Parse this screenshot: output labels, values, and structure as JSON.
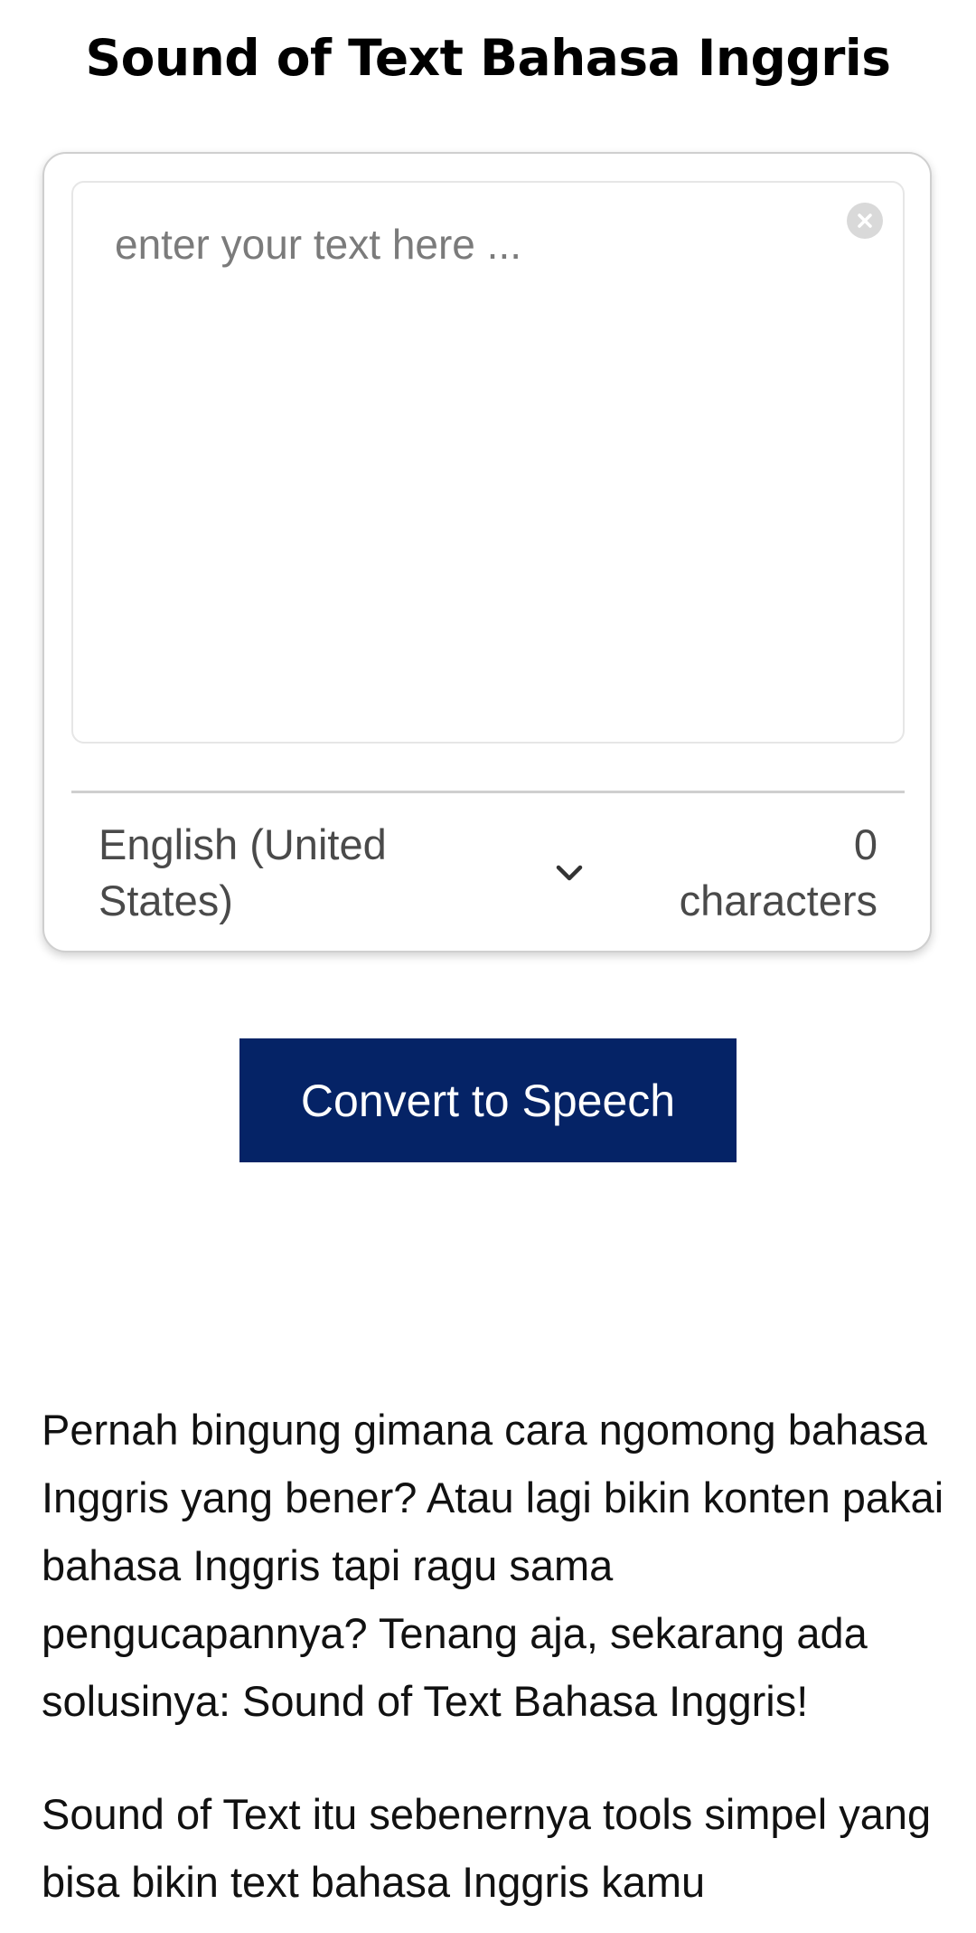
{
  "page": {
    "title": "Sound of Text Bahasa Inggris"
  },
  "editor": {
    "placeholder": "enter your text here ...",
    "value": "",
    "clear_icon": "close-circle-icon"
  },
  "language": {
    "line1": "English (United",
    "line2": "States)",
    "icon": "chevron-down-icon"
  },
  "counter": {
    "count": "0",
    "unit": "characters"
  },
  "actions": {
    "convert_label": "Convert to Speech"
  },
  "article": {
    "paragraphs": [
      "Pernah bingung gimana cara ngomong bahasa Inggris yang bener? Atau lagi bikin konten pakai bahasa Inggris tapi ragu sama pengucapannya? Tenang aja, sekarang ada solusinya: Sound of Text Bahasa Inggris!",
      "Sound of Text itu sebenernya tools simpel yang bisa bikin text bahasa Inggris kamu"
    ]
  },
  "colors": {
    "button_bg": "#052366",
    "button_text": "#ffffff",
    "card_border": "#cfcfcf"
  }
}
